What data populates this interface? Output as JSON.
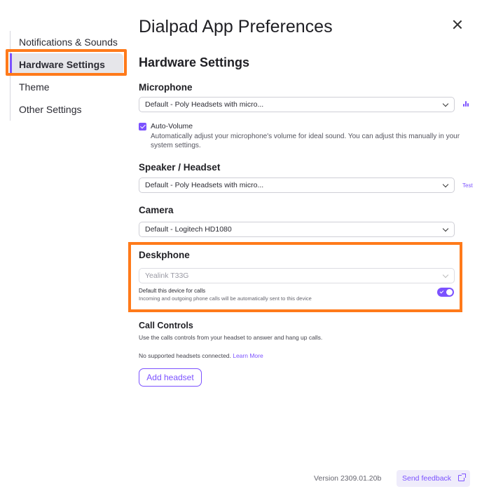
{
  "sidebar": {
    "items": [
      {
        "label": "Notifications & Sounds"
      },
      {
        "label": "Hardware Settings"
      },
      {
        "label": "Theme"
      },
      {
        "label": "Other Settings"
      }
    ]
  },
  "header": {
    "title": "Dialpad App Preferences"
  },
  "section": {
    "title": "Hardware Settings"
  },
  "microphone": {
    "label": "Microphone",
    "selected": "Default - Poly Headsets with micro...",
    "auto_volume_label": "Auto-Volume",
    "auto_volume_checked": true,
    "auto_volume_desc": "Automatically adjust your microphone's volume for ideal sound. You can adjust this manually in your system settings."
  },
  "speaker": {
    "label": "Speaker / Headset",
    "selected": "Default - Poly Headsets with micro...",
    "test_label": "Test"
  },
  "camera": {
    "label": "Camera",
    "selected": "Default - Logitech HD1080"
  },
  "deskphone": {
    "label": "Deskphone",
    "selected": "Yealink T33G",
    "default_label": "Default this device for calls",
    "default_desc": "Incoming and outgoing phone calls will be automatically sent to this device",
    "default_enabled": true
  },
  "call_controls": {
    "label": "Call Controls",
    "desc": "Use the calls controls from your headset to answer and hang up calls.",
    "no_headset": "No supported headsets connected.",
    "learn_more": "Learn More",
    "add_button": "Add headset"
  },
  "footer": {
    "version": "Version 2309.01.20b",
    "feedback": "Send feedback"
  },
  "colors": {
    "accent": "#7c52ff",
    "highlight": "#ff7a1a"
  }
}
